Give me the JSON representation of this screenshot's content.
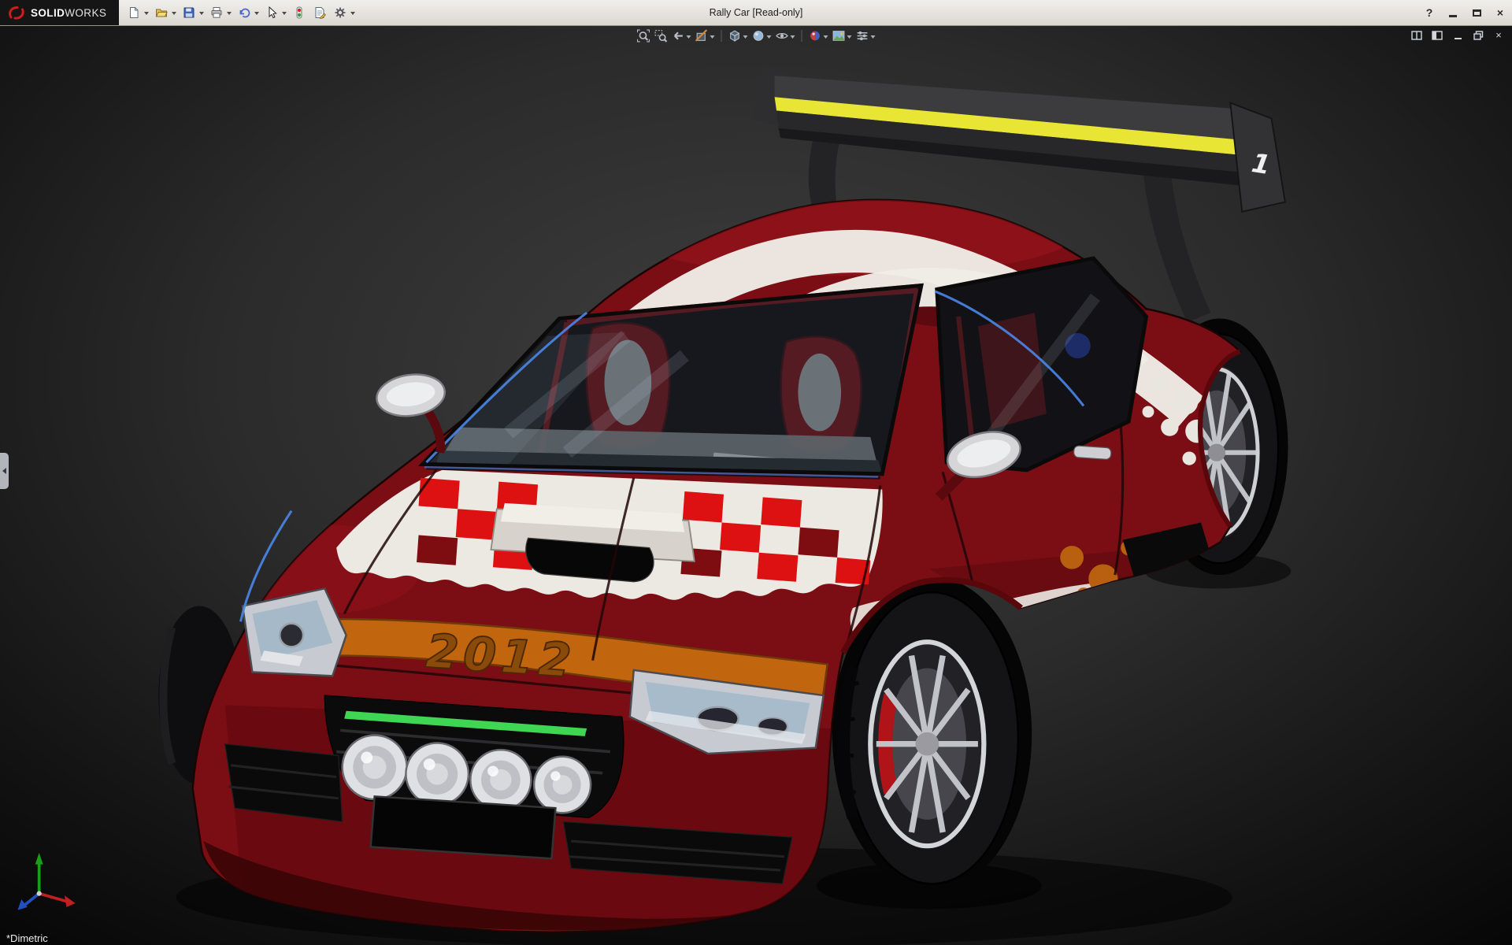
{
  "window": {
    "brand_bold": "SOLID",
    "brand_light": "WORKS",
    "title": "Rally Car [Read-only]"
  },
  "glyphs": {
    "help": "?",
    "close": "×"
  },
  "titlebar_tools": [
    {
      "icon": "new-document-icon",
      "dropdown": true
    },
    {
      "icon": "open-folder-icon",
      "dropdown": true
    },
    {
      "icon": "save-icon",
      "dropdown": true
    },
    {
      "icon": "print-icon",
      "dropdown": true
    },
    {
      "icon": "undo-icon",
      "dropdown": true
    },
    {
      "icon": "select-arrow-icon",
      "dropdown": true
    },
    {
      "icon": "rebuild-icon",
      "dropdown": false
    },
    {
      "icon": "file-properties-icon",
      "dropdown": false
    },
    {
      "icon": "options-gear-icon",
      "dropdown": true
    }
  ],
  "heads_up_tools": [
    {
      "icon": "zoom-to-fit-icon",
      "dropdown": false
    },
    {
      "icon": "zoom-to-area-icon",
      "dropdown": false
    },
    {
      "icon": "previous-view-icon",
      "dropdown": true
    },
    {
      "icon": "section-view-icon",
      "dropdown": true
    },
    {
      "icon": "view-orientation-icon",
      "dropdown": true
    },
    {
      "icon": "display-style-icon",
      "dropdown": true
    },
    {
      "icon": "hide-show-items-icon",
      "dropdown": true
    },
    {
      "icon": "edit-appearance-icon",
      "dropdown": true
    },
    {
      "icon": "apply-scene-icon",
      "dropdown": true
    },
    {
      "icon": "view-settings-icon",
      "dropdown": true
    }
  ],
  "document_controls": [
    "split-pane",
    "show-pane",
    "minimize",
    "restore",
    "close"
  ],
  "viewport": {
    "orientation_label": "*Dimetric",
    "decals": {
      "hood_year": "2012",
      "wing_number": "1"
    },
    "colors": {
      "body": "#7b0e14",
      "stripe": "#efece6",
      "accent_band": "#c1660e",
      "wing_stripe": "#e9e535",
      "grille_led": "#3fd653",
      "seat": "#8c1016",
      "background_top": "#3e3e3e",
      "background_bottom": "#060606"
    }
  }
}
